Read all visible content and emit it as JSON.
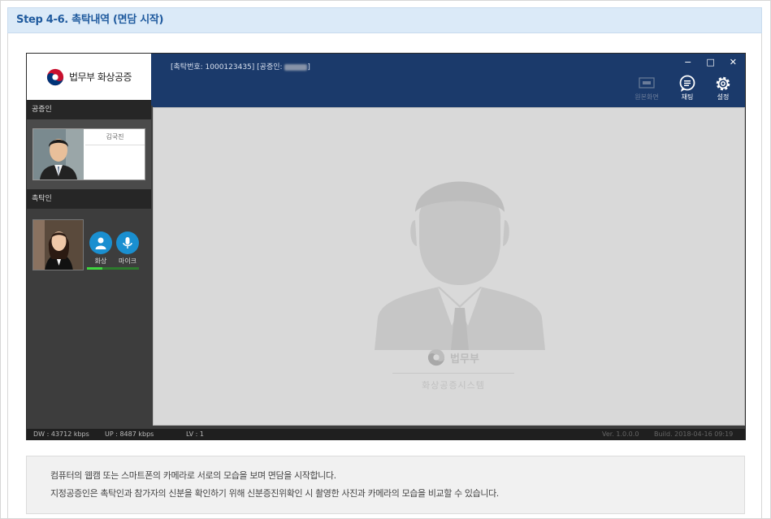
{
  "header": {
    "title": "Step 4-6. 촉탁내역 (면담 시작)"
  },
  "app": {
    "logo_text": "법무부 화상공증",
    "case_info_prefix": "[촉탁번호: 1000123435] [공증인:",
    "case_info_suffix": "]",
    "window_controls": {
      "minimize": "−",
      "maximize": "□",
      "close": "✕"
    },
    "toolbar": [
      {
        "label": "원본화면",
        "icon": "screen-icon",
        "enabled": false
      },
      {
        "label": "채팅",
        "icon": "chat-icon",
        "enabled": true
      },
      {
        "label": "설정",
        "icon": "gear-icon",
        "enabled": true
      }
    ],
    "sidebar": {
      "notary_section": "공증인",
      "notary_name": "김국진",
      "client_section": "촉탁인",
      "video_label": "화상",
      "mic_label": "마이크",
      "mic_level": 0.3
    },
    "main_view": {
      "brand": "법무부",
      "system_name": "화상공증시스템"
    },
    "status": {
      "dw": "DW : 43712 kbps",
      "up": "UP : 8487 kbps",
      "lv": "LV : 1",
      "version": "Ver. 1.0.0.0",
      "build": "Build. 2018-04-16 09:19"
    },
    "colors": {
      "titlebar": "#1b3a6b",
      "accent": "#1a8fd0",
      "sidebar": "#3d3d3d"
    }
  },
  "note": {
    "line1": "컴퓨터의 웹캠 또는 스마트폰의 카메라로 서로의 모습을 보며 면담을 시작합니다.",
    "line2": "지정공증인은 촉탁인과 참가자의 신분을 확인하기 위해 신분증진위확인 시 촬영한 사진과 카메라의 모습을 비교할 수 있습니다."
  }
}
